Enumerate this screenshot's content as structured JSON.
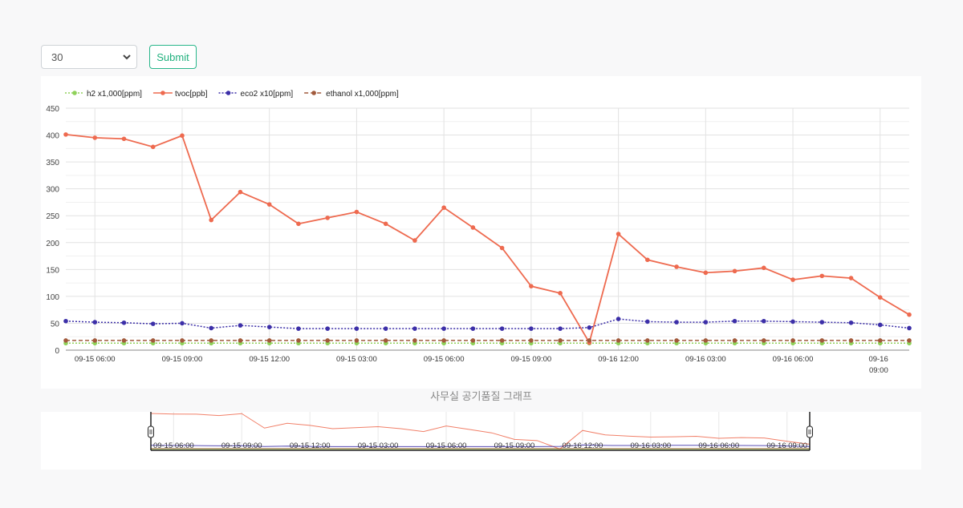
{
  "controls": {
    "select_value": "30",
    "submit_label": "Submit"
  },
  "caption": "사무실 공기품질 그래프",
  "colors": {
    "h2": "#8fd15a",
    "tvoc": "#ee6a4f",
    "eco2": "#3c2fa8",
    "ethanol": "#a15a3c",
    "submit": "#1fb07d"
  },
  "chart_data": {
    "type": "line",
    "legend_placement": "top-left",
    "ylim": [
      0,
      450
    ],
    "yticks": [
      0,
      50,
      100,
      150,
      200,
      250,
      300,
      350,
      400,
      450
    ],
    "x": [
      "09-15 05:00",
      "09-15 06:00",
      "09-15 07:00",
      "09-15 08:00",
      "09-15 09:00",
      "09-15 10:00",
      "09-15 11:00",
      "09-15 12:00",
      "09-15 13:00",
      "09-15 14:00",
      "09-15 15:00",
      "09-15 16:00",
      "09-15 17:00",
      "09-15 18:00",
      "09-15 19:00",
      "09-15 20:00",
      "09-15 21:00",
      "09-15 22:00",
      "09-15 23:00",
      "09-16 00:00",
      "09-16 01:00",
      "09-16 02:00",
      "09-16 03:00",
      "09-16 04:00",
      "09-16 05:00",
      "09-16 06:00",
      "09-16 07:00",
      "09-16 08:00",
      "09-16 09:00",
      "09-16 10:00"
    ],
    "xticks": [
      {
        "x": "09-15 06:00",
        "label": "09-15 06:00"
      },
      {
        "x": "09-15 09:00",
        "label": "09-15 09:00"
      },
      {
        "x": "09-15 12:00",
        "label": "09-15 12:00"
      },
      {
        "x": "09-15 15:00",
        "label": "09-15 03:00"
      },
      {
        "x": "09-15 18:00",
        "label": "09-15 06:00"
      },
      {
        "x": "09-15 21:00",
        "label": "09-15 09:00"
      },
      {
        "x": "09-16 00:00",
        "label": "09-16 12:00"
      },
      {
        "x": "09-16 03:00",
        "label": "09-16 03:00"
      },
      {
        "x": "09-16 06:00",
        "label": "09-16 06:00"
      },
      {
        "x": "09-16 09:00",
        "label": "09-16 09:00"
      }
    ],
    "series": [
      {
        "key": "h2",
        "name": "h2 x1,000[ppm]",
        "style": "dotted",
        "values": [
          13,
          13,
          13,
          13,
          13,
          13,
          13,
          13,
          13,
          13,
          13,
          13,
          13,
          13,
          13,
          13,
          13,
          13,
          13,
          13,
          13,
          13,
          13,
          13,
          13,
          13,
          13,
          13,
          13,
          13
        ]
      },
      {
        "key": "tvoc",
        "name": "tvoc[ppb]",
        "style": "solid",
        "values": [
          401,
          395,
          393,
          378,
          399,
          242,
          294,
          271,
          235,
          246,
          257,
          235,
          204,
          265,
          228,
          190,
          119,
          106,
          14,
          216,
          168,
          155,
          144,
          147,
          153,
          131,
          138,
          134,
          98,
          66
        ]
      },
      {
        "key": "eco2",
        "name": "eco2 x10[ppm]",
        "style": "dotted",
        "values": [
          54,
          52,
          51,
          49,
          50,
          41,
          46,
          43,
          40,
          40,
          40,
          40,
          40,
          40,
          40,
          40,
          40,
          40,
          42,
          58,
          53,
          52,
          52,
          54,
          54,
          53,
          52,
          51,
          47,
          41
        ]
      },
      {
        "key": "ethanol",
        "name": "ethanol x1,000[ppm]",
        "style": "dashed",
        "values": [
          18,
          18,
          18,
          18,
          18,
          18,
          18,
          18,
          18,
          18,
          18,
          18,
          18,
          18,
          18,
          18,
          18,
          18,
          18,
          18,
          18,
          18,
          18,
          18,
          18,
          18,
          18,
          18,
          18,
          18
        ]
      }
    ],
    "navigator_labels": [
      "09-15 06:00",
      "09-15 09:00",
      "09-15 12:00",
      "09-15 03:00",
      "09-15 06:00",
      "09-15 09:00",
      "09-16 12:00",
      "09-16 03:00",
      "09-16 06:00",
      "09-16 09:00"
    ]
  }
}
